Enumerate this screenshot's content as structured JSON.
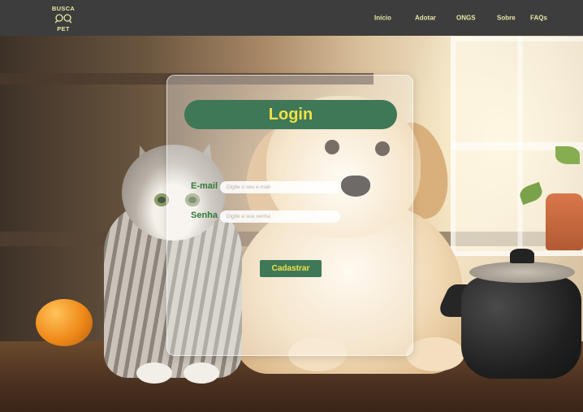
{
  "header": {
    "logo_top": "BUSCA",
    "logo_bottom": "PET",
    "nav": [
      {
        "label": "Início"
      },
      {
        "label": "Adotar"
      },
      {
        "label": "ONGS"
      },
      {
        "label": "Sobre"
      },
      {
        "label": "FAQs"
      }
    ]
  },
  "login": {
    "title": "Login",
    "email_label": "E-mail",
    "email_placeholder": "Digite o seu e-mail",
    "email_value": "",
    "password_label": "Senha",
    "password_placeholder": "Digite a sua senha",
    "password_value": "",
    "submit_label": "Cadastrar"
  },
  "colors": {
    "header_bg": "#3d3d3d",
    "accent_yellow": "#e9e7a6",
    "button_green": "#3f7857",
    "title_yellow": "#f0e14a",
    "label_green": "#2e7a3b"
  }
}
